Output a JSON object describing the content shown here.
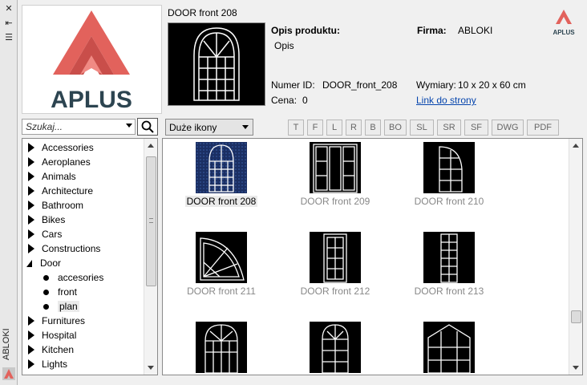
{
  "palette": {
    "vertical_label": "ABLOKI"
  },
  "brand": {
    "name": "APLUS",
    "accent_color": "#e2625c",
    "text_color": "#2c4450"
  },
  "product": {
    "title": "DOOR front 208",
    "description_label": "Opis produktu:",
    "description_value": "Opis",
    "company_label": "Firma:",
    "company_value": "ABLOKI",
    "id_label": "Numer ID:",
    "id_value": "DOOR_front_208",
    "price_label": "Cena:",
    "price_value": "0",
    "dimensions_label": "Wymiary:",
    "dimensions_value": "10 x 20 x 60 cm",
    "link_label": "Link do strony"
  },
  "search": {
    "placeholder": "Szukaj..."
  },
  "view_mode": {
    "selected": "Duże ikony"
  },
  "filters": [
    "T",
    "F",
    "L",
    "R",
    "B",
    "BO",
    "SL",
    "SR",
    "SF",
    "DWG",
    "PDF"
  ],
  "tree": {
    "items": [
      {
        "label": "Accessories",
        "kind": "collapsed"
      },
      {
        "label": "Aeroplanes",
        "kind": "collapsed"
      },
      {
        "label": "Animals",
        "kind": "collapsed"
      },
      {
        "label": "Architecture",
        "kind": "collapsed"
      },
      {
        "label": "Bathroom",
        "kind": "collapsed"
      },
      {
        "label": "Bikes",
        "kind": "collapsed"
      },
      {
        "label": "Cars",
        "kind": "collapsed"
      },
      {
        "label": "Constructions",
        "kind": "collapsed"
      },
      {
        "label": "Door",
        "kind": "expanded"
      },
      {
        "label": "accesories",
        "kind": "leaf"
      },
      {
        "label": "front",
        "kind": "leaf"
      },
      {
        "label": "plan",
        "kind": "leaf",
        "selected": true
      },
      {
        "label": "Furnitures",
        "kind": "collapsed"
      },
      {
        "label": "Hospital",
        "kind": "collapsed"
      },
      {
        "label": "Kitchen",
        "kind": "collapsed"
      },
      {
        "label": "Lights",
        "kind": "collapsed"
      }
    ]
  },
  "tiles": [
    {
      "caption": "DOOR front 208",
      "style": "arch",
      "selected": true
    },
    {
      "caption": "DOOR front 209",
      "style": "double"
    },
    {
      "caption": "DOOR front 210",
      "style": "quarter"
    },
    {
      "caption": "DOOR front 211",
      "style": "fan"
    },
    {
      "caption": "DOOR front 212",
      "style": "panel"
    },
    {
      "caption": "DOOR front 213",
      "style": "narrow"
    },
    {
      "caption": "",
      "style": "arch2"
    },
    {
      "caption": "",
      "style": "arch3"
    },
    {
      "caption": "",
      "style": "gable"
    }
  ]
}
